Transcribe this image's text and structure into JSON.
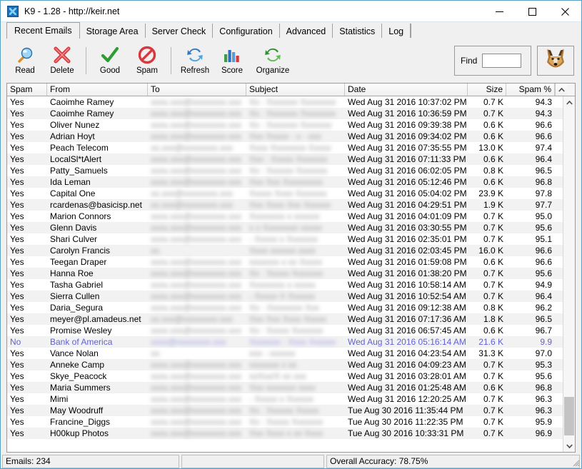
{
  "window": {
    "title": "K9 - 1.28 - http://keir.net",
    "app_icon": "k9-app-icon",
    "minimize": "minimize-button",
    "maximize": "maximize-button",
    "close": "close-button"
  },
  "tabs": [
    {
      "label": "Recent Emails",
      "active": true
    },
    {
      "label": "Storage Area",
      "active": false
    },
    {
      "label": "Server Check",
      "active": false
    },
    {
      "label": "Configuration",
      "active": false
    },
    {
      "label": "Advanced",
      "active": false
    },
    {
      "label": "Statistics",
      "active": false
    },
    {
      "label": "Log",
      "active": false
    }
  ],
  "toolbar": {
    "buttons": [
      {
        "label": "Read",
        "icon": "magnifier-icon"
      },
      {
        "label": "Delete",
        "icon": "red-x-icon"
      },
      {
        "label": "Good",
        "icon": "green-check-icon"
      },
      {
        "label": "Spam",
        "icon": "no-entry-icon"
      },
      {
        "label": "Refresh",
        "icon": "blue-refresh-icon"
      },
      {
        "label": "Score",
        "icon": "bar-chart-icon"
      },
      {
        "label": "Organize",
        "icon": "green-refresh-icon"
      }
    ],
    "find_label": "Find",
    "find_value": "",
    "find_placeholder": "",
    "fox_icon": "fox-head-icon"
  },
  "grid": {
    "columns": [
      {
        "key": "spam",
        "label": "Spam",
        "width": 56,
        "align": "left"
      },
      {
        "key": "from",
        "label": "From",
        "width": 141,
        "align": "left"
      },
      {
        "key": "to",
        "label": "To",
        "width": 138,
        "align": "left",
        "redacted": true
      },
      {
        "key": "subject",
        "label": "Subject",
        "width": 138,
        "align": "left",
        "redacted": true
      },
      {
        "key": "date",
        "label": "Date",
        "width": 172,
        "align": "left"
      },
      {
        "key": "size",
        "label": "Size",
        "width": 54,
        "align": "right"
      },
      {
        "key": "spampct",
        "label": "Spam %",
        "width": 68,
        "align": "right"
      }
    ],
    "rows": [
      {
        "spam": "Yes",
        "from": "Caoimhe Ramey",
        "to": "xxxx.xxx@xxxxxxxx.xxx",
        "subject": "Xx : Xxxxxxx Xxxxxxxx",
        "date": "Wed Aug 31 2016  10:37:02 PM",
        "size": "0.7 K",
        "spampct": "94.3",
        "ham": false
      },
      {
        "spam": "Yes",
        "from": "Caoimhe Ramey",
        "to": "xxxx.xxx@xxxxxxxx.xxx",
        "subject": "Xx : Xxxxxxx Xxxxxxxx",
        "date": "Wed Aug 31 2016  10:36:59 PM",
        "size": "0.7 K",
        "spampct": "94.3",
        "ham": false
      },
      {
        "spam": "Yes",
        "from": "Oliver Nunez",
        "to": "xxxx.xxx@xxxxxxxx.xxx",
        "subject": "Xx : Xxxxxxx Xxxxxxx",
        "date": "Wed Aug 31 2016  09:39:38 PM",
        "size": "0.6 K",
        "spampct": "96.6",
        "ham": false
      },
      {
        "spam": "Yes",
        "from": "Adrian Hoyt",
        "to": "xxxx.xxx@xxxxxxxx.xxx",
        "subject": "Xxx Xxxxx - x - xxx",
        "date": "Wed Aug 31 2016  09:34:02 PM",
        "size": "0.6 K",
        "spampct": "96.6",
        "ham": false
      },
      {
        "spam": "Yes",
        "from": "Peach Telecom",
        "to": "xx.xxx@xxxxxxxx.xxx",
        "subject": "Xxxx Xxxxxxxx Xxxxx",
        "date": "Wed Aug 31 2016  07:35:55 PM",
        "size": "13.0 K",
        "spampct": "97.4",
        "ham": false
      },
      {
        "spam": "Yes",
        "from": "LocalSl*tAlert",
        "to": "xxxx.xxx@xxxxxxxx.xxx",
        "subject": "Xxx : Xxxxx Xxxxxxx",
        "date": "Wed Aug 31 2016  07:11:33 PM",
        "size": "0.6 K",
        "spampct": "96.4",
        "ham": false
      },
      {
        "spam": "Yes",
        "from": "Patty_Samuels",
        "to": "xxxx.xxx@xxxxxxxx.xxx",
        "subject": "Xx : Xxxxxx Xxxxxxx",
        "date": "Wed Aug 31 2016  06:02:05 PM",
        "size": "0.8 K",
        "spampct": "96.5",
        "ham": false
      },
      {
        "spam": "Yes",
        "from": "Ida Leman",
        "to": "xxxx.xxx@xxxxxxxx.xxx",
        "subject": "Xxx Xxx Xxxxxxxxx",
        "date": "Wed Aug 31 2016  05:12:46 PM",
        "size": "0.6 K",
        "spampct": "96.8",
        "ham": false
      },
      {
        "spam": "Yes",
        "from": "Capital One",
        "to": "xx.xxx@xxxxxxxx.xxx",
        "subject": "Xxxxx  Xxxx Xxxxxxx",
        "date": "Wed Aug 31 2016  05:04:02 PM",
        "size": "23.9 K",
        "spampct": "97.8",
        "ham": false
      },
      {
        "spam": "Yes",
        "from": "rcardenas@basicisp.net",
        "to": "xx.xxx@xxxxxxxx.xxx",
        "subject": "Xxx Xxxx Xxx Xxxxxx",
        "date": "Wed Aug 31 2016  04:29:51 PM",
        "size": "1.9 K",
        "spampct": "97.7",
        "ham": false
      },
      {
        "spam": "Yes",
        "from": "Marion Connors",
        "to": "xxxx.xxx@xxxxxxxx.xxx",
        "subject": "Xxxxxxxx x xxxxxx",
        "date": "Wed Aug 31 2016  04:01:09 PM",
        "size": "0.7 K",
        "spampct": "95.0",
        "ham": false
      },
      {
        "spam": "Yes",
        "from": "Glenn Davis",
        "to": "xxxx.xxx@xxxxxxxx.xxx",
        "subject": "x x Xxxxxxxx xxxxx",
        "date": "Wed Aug 31 2016  03:30:55 PM",
        "size": "0.7 K",
        "spampct": "95.6",
        "ham": false
      },
      {
        "spam": "Yes",
        "from": "Shari Culver",
        "to": "xxxx.xxx@xxxxxxxx.xxx",
        "subject": "- Xxxxx x Xxxxxxx",
        "date": "Wed Aug 31 2016  02:35:01 PM",
        "size": "0.7 K",
        "spampct": "95.1",
        "ham": false
      },
      {
        "spam": "Yes",
        "from": "Carolyn Francis",
        "to": "xx.",
        "subject": "Xxxx xxxxxx xxxx",
        "date": "Wed Aug 31 2016  02:03:45 PM",
        "size": "16.0 K",
        "spampct": "96.6",
        "ham": false
      },
      {
        "spam": "Yes",
        "from": "Teegan Draper",
        "to": "xxxx.xxx@xxxxxxxx.xxx",
        "subject": "xxxxxxx x xx Xxxxx",
        "date": "Wed Aug 31 2016  01:59:08 PM",
        "size": "0.6 K",
        "spampct": "96.6",
        "ham": false
      },
      {
        "spam": "Yes",
        "from": "Hanna Roe",
        "to": "xxxx.xxx@xxxxxxxx.xxx",
        "subject": "Xx : Xxxxx Xxxxxxx",
        "date": "Wed Aug 31 2016  01:38:20 PM",
        "size": "0.7 K",
        "spampct": "95.6",
        "ham": false
      },
      {
        "spam": "Yes",
        "from": "Tasha Gabriel",
        "to": "xxxx.xxx@xxxxxxxx.xxx",
        "subject": "Xxxxxxxx x xxxxx",
        "date": "Wed Aug 31 2016  10:58:14 AM",
        "size": "0.7 K",
        "spampct": "94.9",
        "ham": false
      },
      {
        "spam": "Yes",
        "from": "Sierra Cullen",
        "to": "xxxx.xxx@xxxxxxxx.xxx",
        "subject": "- Xxxxx X Xxxxxx",
        "date": "Wed Aug 31 2016  10:52:54 AM",
        "size": "0.7 K",
        "spampct": "96.4",
        "ham": false
      },
      {
        "spam": "Yes",
        "from": "Daria_Segura",
        "to": "xxxx.xxx@xxxxxxxx.xxx",
        "subject": "Xx - Xxxxxxxx Xxx",
        "date": "Wed Aug 31 2016  09:12:38 AM",
        "size": "0.8 K",
        "spampct": "96.2",
        "ham": false
      },
      {
        "spam": "Yes",
        "from": "meyer@pl.amadeus.net",
        "to": "xx.xxx@xxxxxxxx.xxx",
        "subject": "Xxx Xxx Xxxx Xxxxx",
        "date": "Wed Aug 31 2016  07:17:36 AM",
        "size": "1.8 K",
        "spampct": "96.5",
        "ham": false
      },
      {
        "spam": "Yes",
        "from": "Promise Wesley",
        "to": "xxxx.xxx@xxxxxxxx.xxx",
        "subject": "Xx : Xxxxx Xxxxxxx",
        "date": "Wed Aug 31 2016  06:57:45 AM",
        "size": "0.6 K",
        "spampct": "96.7",
        "ham": false
      },
      {
        "spam": "No",
        "from": "Bank of America",
        "to": "xxxx@xxxxxxxx.xxx",
        "subject": "Xxxxxxx : Xxxx Xxxxxx",
        "date": "Wed Aug 31 2016  05:16:14 AM",
        "size": "21.6 K",
        "spampct": "9.9",
        "ham": true
      },
      {
        "spam": "Yes",
        "from": "Vance Nolan",
        "to": "xx.",
        "subject": "xxx - xxxxxx",
        "date": "Wed Aug 31 2016  04:23:54 AM",
        "size": "31.3 K",
        "spampct": "97.0",
        "ham": false
      },
      {
        "spam": "Yes",
        "from": "Anneke Camp",
        "to": "xxxx.xxx@xxxxxxxx.xxx",
        "subject": "xxxxxxx x xx",
        "date": "Wed Aug 31 2016  04:09:23 AM",
        "size": "0.7 K",
        "spampct": "95.3",
        "ham": false
      },
      {
        "spam": "Yes",
        "from": "Skye_Peacock",
        "to": "xxxx.xxx@xxxxxxxx.xxx",
        "subject": "xxXxx/X xx xxx",
        "date": "Wed Aug 31 2016  03:28:01 AM",
        "size": "0.7 K",
        "spampct": "95.6",
        "ham": false
      },
      {
        "spam": "Yes",
        "from": "Maria Summers",
        "to": "xxxx.xxx@xxxxxxxx.xxx",
        "subject": "Xxx xxxxxxx xxxx",
        "date": "Wed Aug 31 2016  01:25:48 AM",
        "size": "0.6 K",
        "spampct": "96.8",
        "ham": false
      },
      {
        "spam": "Yes",
        "from": "Mimi",
        "to": "xxxx.xxx@xxxxxxxx.xxx",
        "subject": "- Xxxxx x Xxxxxx",
        "date": "Wed Aug 31 2016  12:20:25 AM",
        "size": "0.7 K",
        "spampct": "96.3",
        "ham": false
      },
      {
        "spam": "Yes",
        "from": "May Woodruff",
        "to": "xxxx.xxx@xxxxxxxx.xxx",
        "subject": "Xx : Xxxxxx Xxxxx",
        "date": "Tue Aug 30 2016  11:35:44 PM",
        "size": "0.7 K",
        "spampct": "96.3",
        "ham": false
      },
      {
        "spam": "Yes",
        "from": "Francine_Diggs",
        "to": "xxxx.xxx@xxxxxxxx.xxx",
        "subject": "Xx : Xxxxx Xxxxxxx",
        "date": "Tue Aug 30 2016  11:22:35 PM",
        "size": "0.7 K",
        "spampct": "95.9",
        "ham": false
      },
      {
        "spam": "Yes",
        "from": "H00kup Photos",
        "to": "xxxx.xxx@xxxxxxxx.xxx",
        "subject": "Xxx Xxxx x xx Xxxx",
        "date": "Tue Aug 30 2016  10:33:31 PM",
        "size": "0.7 K",
        "spampct": "96.9",
        "ham": false
      }
    ]
  },
  "statusbar": {
    "emails": "Emails: 234",
    "middle": "",
    "accuracy": "Overall Accuracy: 78.75%"
  },
  "colors": {
    "ham_text": "#6161d6",
    "window_border": "#5a9fc4",
    "chrome_bg": "#f0f0f0",
    "row_alt": "#f2f2f2"
  }
}
